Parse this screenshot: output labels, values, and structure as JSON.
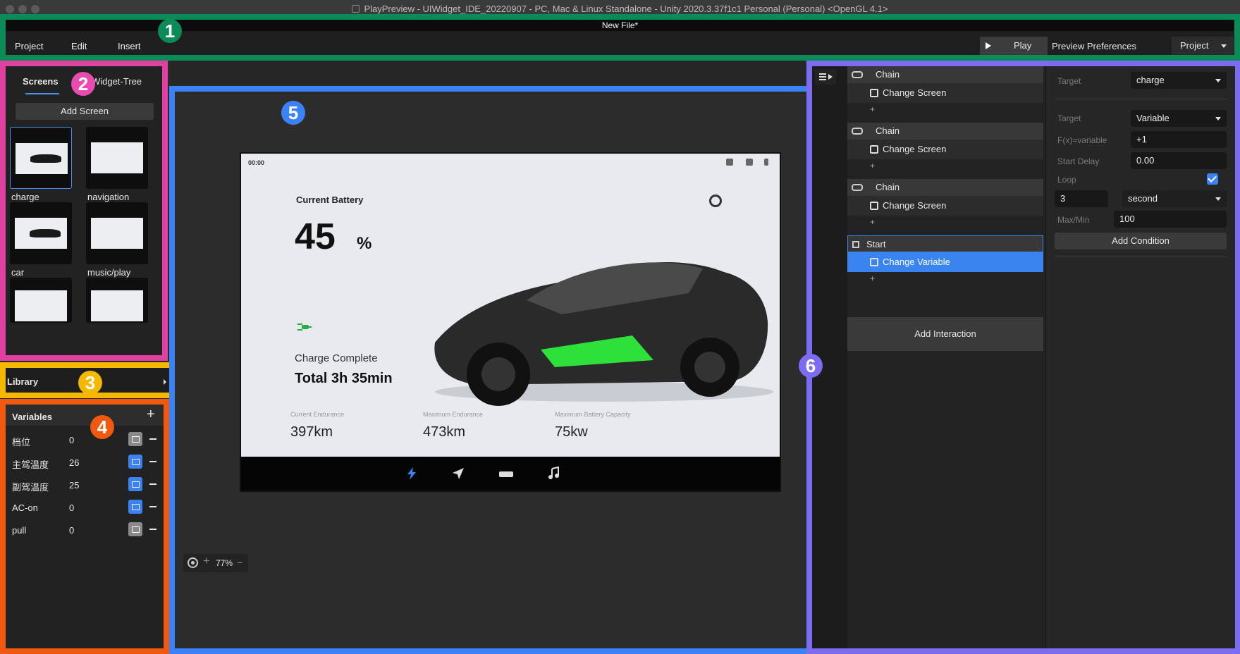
{
  "window": {
    "title": "PlayPreview - UIWidget_IDE_20220907 - PC, Mac & Linux Standalone - Unity 2020.3.37f1c1 Personal (Personal) <OpenGL 4.1>"
  },
  "menubar": {
    "file_name": "New File*",
    "items": [
      "Project",
      "Edit",
      "Insert"
    ],
    "play_label": "Play",
    "preview_prefs_label": "Preview Preferences",
    "project_select": "Project"
  },
  "badges": [
    "1",
    "2",
    "3",
    "4",
    "5",
    "6"
  ],
  "screens_panel": {
    "tabs": [
      "Screens",
      "Widget-Tree"
    ],
    "add_screen_label": "Add Screen",
    "screens": [
      "charge",
      "navigation",
      "car",
      "music/play"
    ]
  },
  "library": {
    "label": "Library"
  },
  "variables": {
    "title": "Variables",
    "add_icon": "+",
    "items": [
      {
        "name": "档位",
        "value": "0",
        "toggle_color": "#8a8a8a"
      },
      {
        "name": "主驾温度",
        "value": "26",
        "toggle_color": "#3b82f6"
      },
      {
        "name": "副驾温度",
        "value": "25",
        "toggle_color": "#3b82f6"
      },
      {
        "name": "AC-on",
        "value": "0",
        "toggle_color": "#3b82f6"
      },
      {
        "name": "pull",
        "value": "0",
        "toggle_color": "#8a8a8a"
      }
    ]
  },
  "preview": {
    "status_time": "00:00",
    "battery_title": "Current Battery",
    "battery_value": "45",
    "battery_unit": "%",
    "charge_complete": "Charge Complete",
    "charge_total": "Total 3h 35min",
    "stats": [
      {
        "label": "Current Endurance",
        "value": "397km"
      },
      {
        "label": "Maximum Endurance",
        "value": "473km"
      },
      {
        "label": "Maximum Battery Capacity",
        "value": "75kw"
      }
    ],
    "nav_icons": [
      "bolt-icon",
      "navigation-icon",
      "car-icon",
      "music-icon"
    ]
  },
  "zoom": {
    "plus": "+",
    "value": "77%",
    "minus": "−"
  },
  "interactions": {
    "chains": [
      {
        "header": "Chain",
        "action": "Change Screen"
      },
      {
        "header": "Chain",
        "action": "Change Screen"
      },
      {
        "header": "Chain",
        "action": "Change Screen"
      },
      {
        "header": "Start",
        "action": "Change Variable"
      }
    ],
    "add_row": "+",
    "add_interaction_label": "Add Interaction"
  },
  "properties": {
    "target_label": "Target",
    "target_value": "charge",
    "target2_label": "Target",
    "target2_value": "Variable",
    "fx_label": "F(x)=variable",
    "fx_value": "+1",
    "start_delay_label": "Start Delay",
    "start_delay_value": "0.00",
    "loop_label": "Loop",
    "loop_checked": true,
    "loop_count": "3",
    "loop_unit": "second",
    "maxmin_label": "Max/Min",
    "maxmin_value": "100",
    "add_condition_label": "Add Condition"
  },
  "colors": {
    "region1": "#0c8a57",
    "region2": "#e040a0",
    "region3": "#f5b800",
    "region4": "#ef5a10",
    "region5": "#3b82f6",
    "region6": "#7c6cf0",
    "accent": "#3b82f6"
  }
}
